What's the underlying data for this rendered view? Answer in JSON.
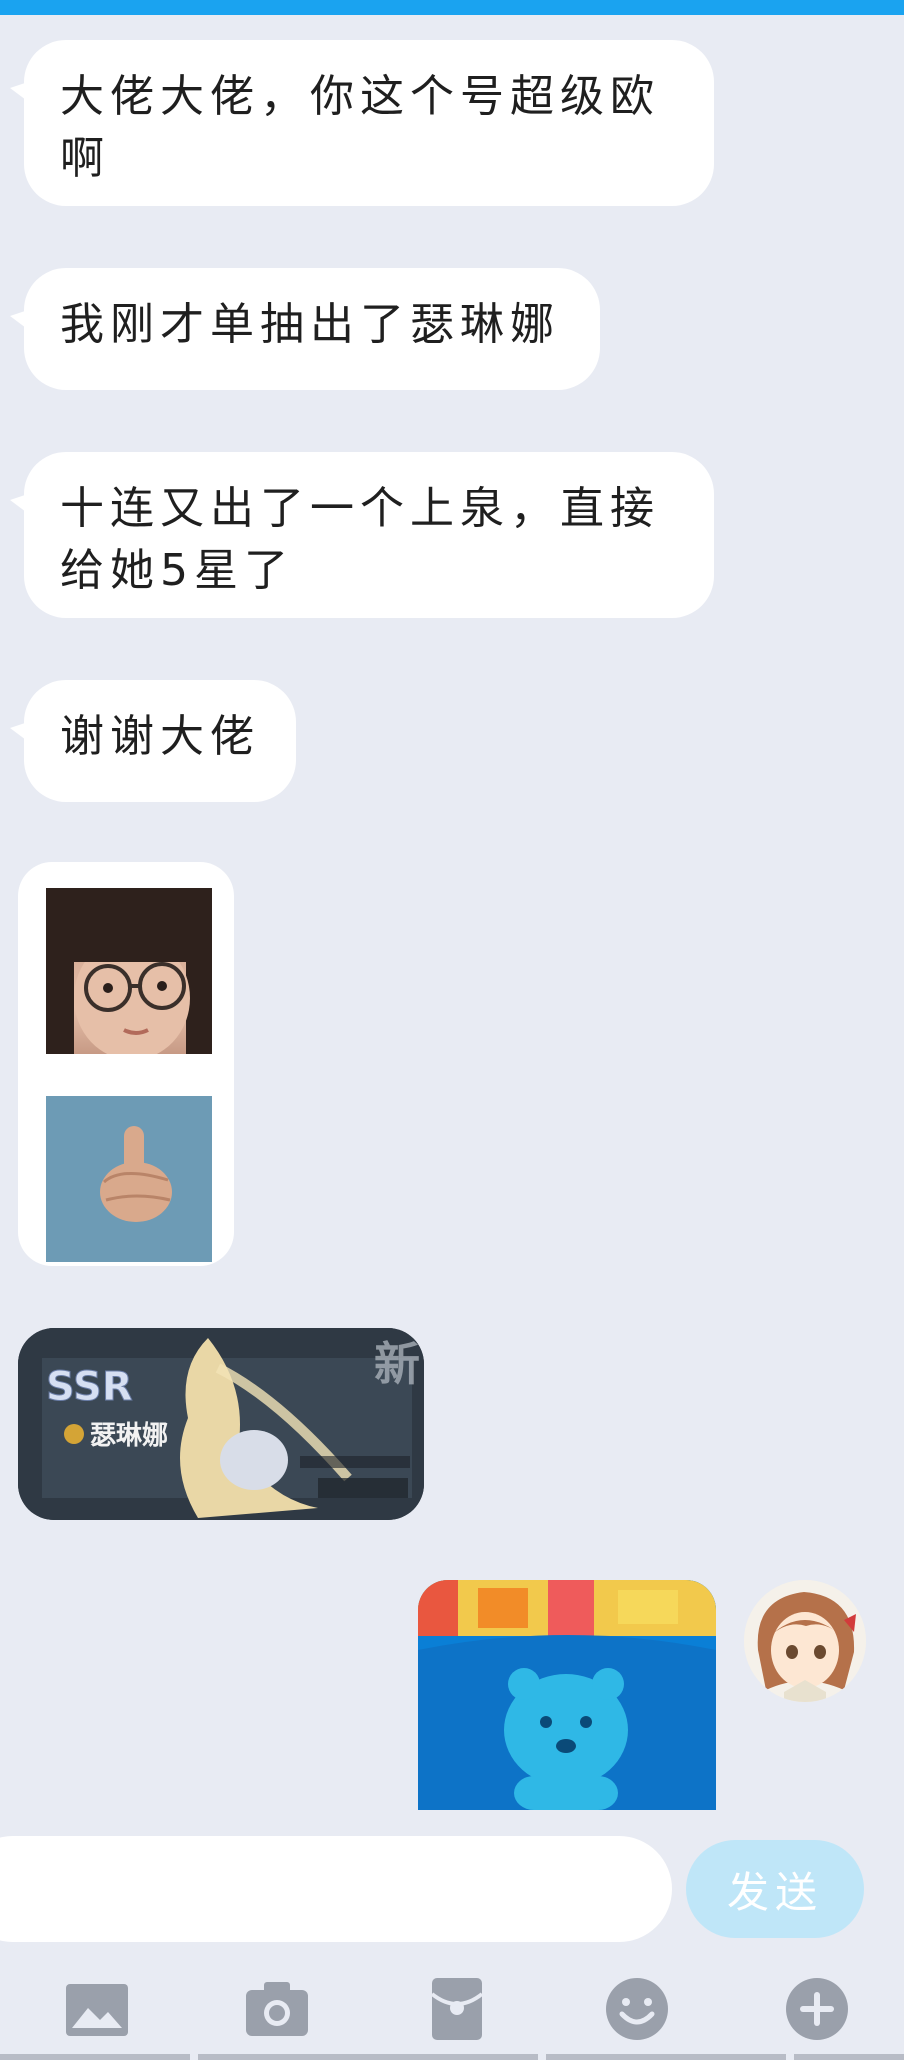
{
  "messages": [
    {
      "text": "大佬大佬，你这个号超级欧啊"
    },
    {
      "text": "我刚才单抽出了瑟琳娜"
    },
    {
      "text": "十连又出了一个上泉，直接给她5星了"
    },
    {
      "text": "谢谢大佬"
    }
  ],
  "game_card": {
    "rarity": "SSR",
    "hero_name": "瑟琳娜",
    "corner": "新"
  },
  "input": {
    "value": "",
    "placeholder": ""
  },
  "send_label": "发送",
  "toolbar": {
    "icons": [
      "image-icon",
      "camera-icon",
      "red-packet-icon",
      "emoji-icon",
      "plus-icon"
    ]
  },
  "colors": {
    "accent": "#1aa3f0",
    "background": "#e8ebf3",
    "send_button": "#bfe6f8",
    "icon": "#9aa0ab"
  }
}
